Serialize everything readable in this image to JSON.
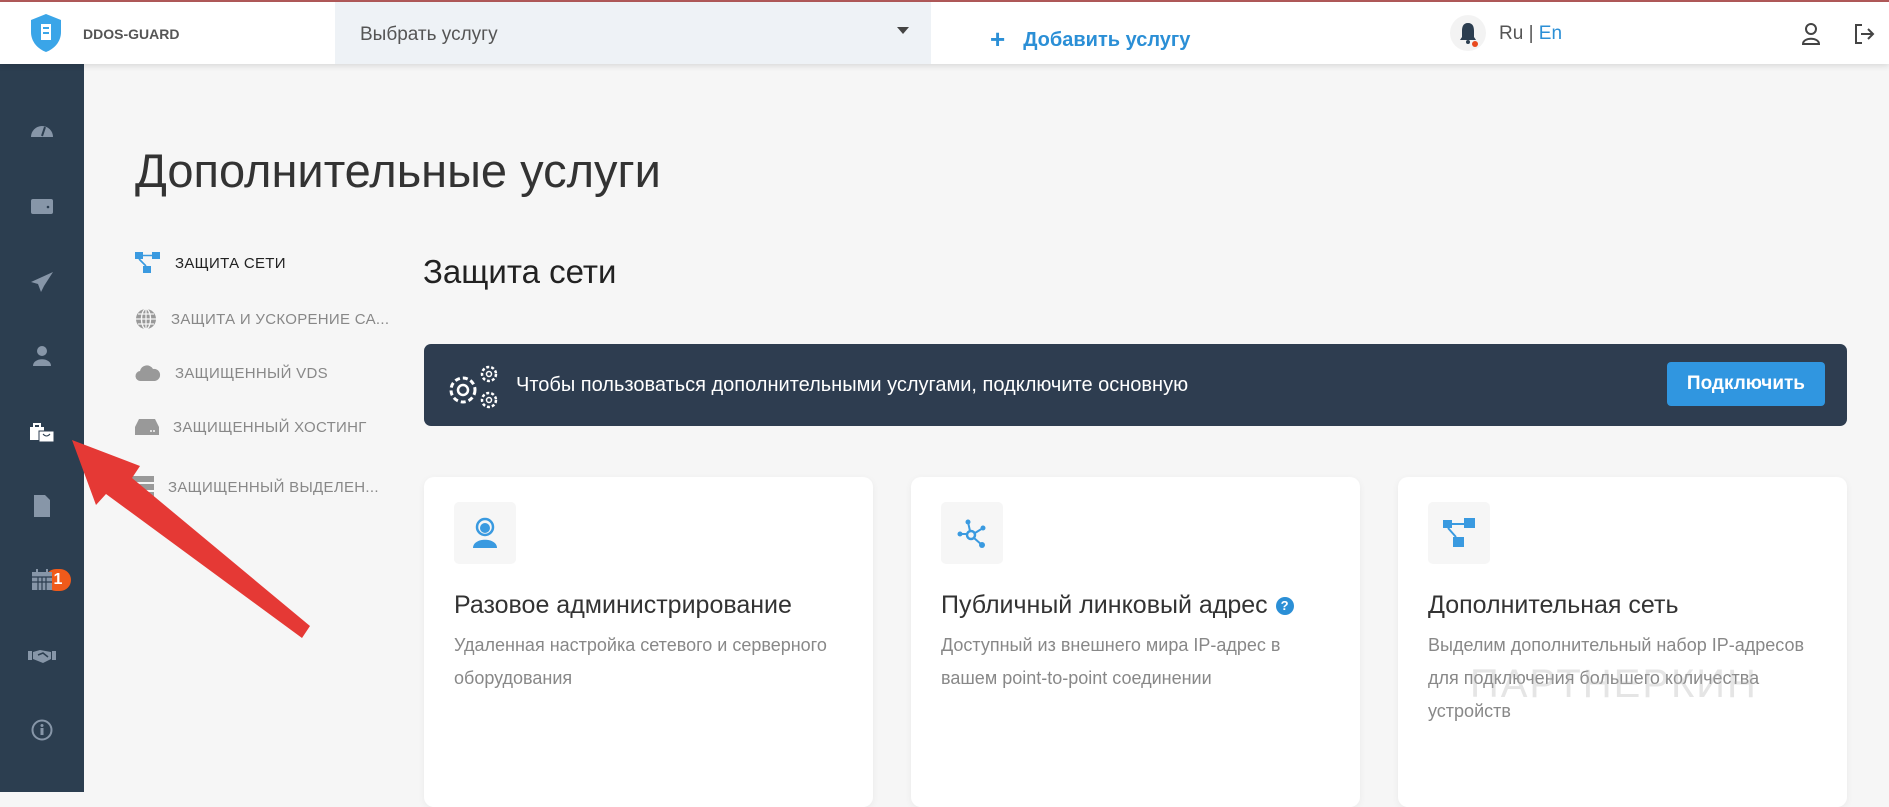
{
  "header": {
    "brand": "DDOS-GUARD",
    "service_select": "Выбрать услугу",
    "add_service": "Добавить услугу",
    "plus": "+",
    "lang_ru": "Ru",
    "lang_sep": "|",
    "lang_en": "En"
  },
  "sidebar": {
    "items": [
      "dashboard",
      "wallet",
      "send",
      "user",
      "services",
      "documents",
      "calendar",
      "partners",
      "info"
    ],
    "documents_badge": "1"
  },
  "page": {
    "title": "Дополнительные услуги"
  },
  "submenu": [
    {
      "label": "Защита сети",
      "icon": "network-icon"
    },
    {
      "label": "Защита и ускорение са...",
      "icon": "globe-icon"
    },
    {
      "label": "Защищенный VDS",
      "icon": "cloud-icon"
    },
    {
      "label": "Защищенный хостинг",
      "icon": "hdd-icon"
    },
    {
      "label": "Защищенный выделен...",
      "icon": "server-icon"
    }
  ],
  "section": {
    "title": "Защита сети"
  },
  "banner": {
    "text": "Чтобы пользоваться дополнительными услугами, подключите основную",
    "button": "Подключить"
  },
  "cards": [
    {
      "title": "Разовое администрирование",
      "desc": "Удаленная настройка сетевого и серверного оборудования"
    },
    {
      "title": "Публичный линковый адрес",
      "help": "?",
      "desc": "Доступный из внешнего мира IP-адрес в вашем point-to-point соединении"
    },
    {
      "title": "Дополнительная сеть",
      "desc": "Выделим дополнительный набор IP-адресов для подключения большего количества устройств"
    }
  ],
  "watermark": "ПАРТНЕРКИН",
  "colors": {
    "accent": "#2b8fd6",
    "sidebar": "#2c3e50",
    "banner": "#2e3d50",
    "badge": "#f05a1a",
    "arrow": "#e53935"
  }
}
